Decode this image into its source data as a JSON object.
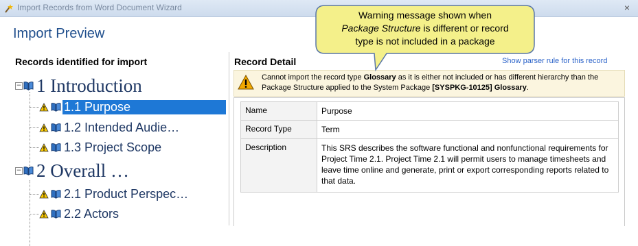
{
  "window": {
    "title": "Import Records from Word Document Wizard",
    "close_glyph": "×",
    "icon": "wizard-wand-icon"
  },
  "header": {
    "title": "Import Preview"
  },
  "left_panel": {
    "title": "Records identified for import",
    "tree": [
      {
        "label": "1 Introduction",
        "level": 1,
        "expanded": true,
        "warning": false
      },
      {
        "label": "1.1 Purpose",
        "level": 2,
        "warning": true,
        "selected": true
      },
      {
        "label": "1.2 Intended Audie…",
        "level": 2,
        "warning": true
      },
      {
        "label": "1.3 Project Scope",
        "level": 2,
        "warning": true
      },
      {
        "label": "2 Overall …",
        "level": 1,
        "expanded": true,
        "warning": false
      },
      {
        "label": "2.1 Product Perspec…",
        "level": 2,
        "warning": true
      },
      {
        "label": "2.2 Actors",
        "level": 2,
        "warning": true
      }
    ]
  },
  "right_panel": {
    "title": "Record Detail",
    "parser_link": "Show parser rule for this record",
    "warning": {
      "t1": "Cannot import the record type ",
      "b1": "Glossary",
      "t2": " as it is either not included or has different hierarchy than the Package Structure applied to the System Package ",
      "b2": "[SYSPKG-10125] Glossary",
      "t3": "."
    },
    "fields": [
      {
        "key": "Name",
        "value": "Purpose"
      },
      {
        "key": "Record Type",
        "value": "Term"
      },
      {
        "key": "Description",
        "value": "This SRS describes the software functional and nonfunctional requirements for Project Time 2.1. Project Time 2.1 will permit users to manage timesheets and leave time online and generate, print or export corresponding reports related to that data."
      }
    ]
  },
  "callout": {
    "line1": "Warning message shown when",
    "line2_italic": "Package Structure",
    "line2_rest": " is different or record",
    "line3": "type is not included in a package"
  },
  "colors": {
    "callout_fill": "#f4f08a",
    "selection": "#1e78d6",
    "link": "#2a62c9",
    "header_title": "#1f4e8c"
  }
}
